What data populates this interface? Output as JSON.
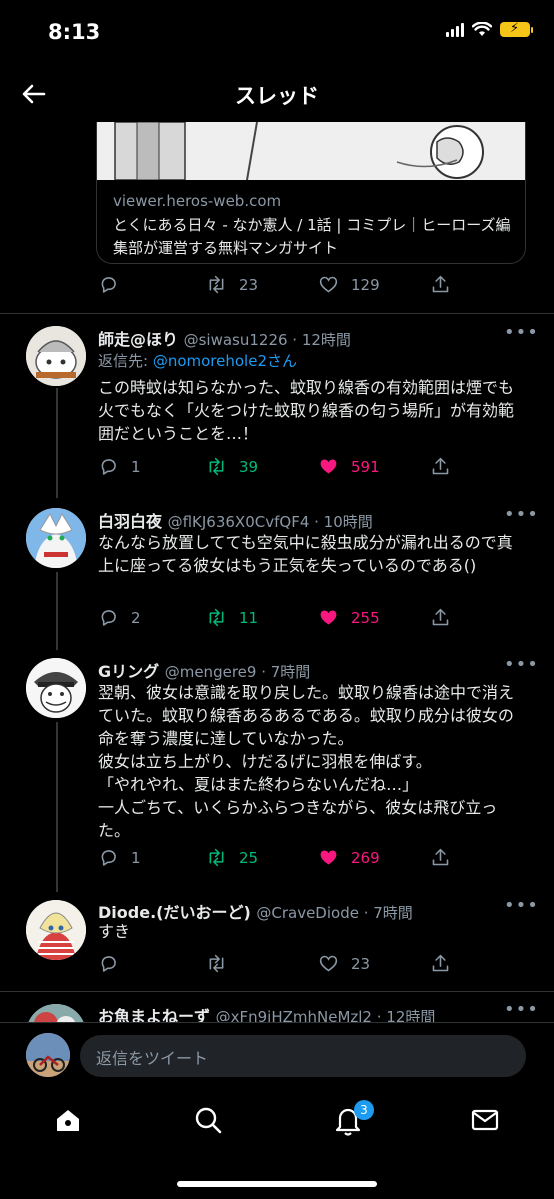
{
  "status_bar": {
    "time": "8:13"
  },
  "header": {
    "title": "スレッド"
  },
  "link_card": {
    "domain": "viewer.heros-web.com",
    "title": "とくにある日々 - なか憲人 / 1話 | コミプレ｜ヒーローズ編集部が運営する無料マンガサイト"
  },
  "top_actions": {
    "retweets": "23",
    "likes": "129"
  },
  "tweets": [
    {
      "name": "師走@ほり",
      "handle": "@siwasu1226 · 12時間",
      "reply_prefix": "返信先: ",
      "reply_to": "@nomorehole2さん",
      "text": "この時蚊は知らなかった、蚊取り線香の有効範囲は煙でも火でもなく「火をつけた蚊取り線香の匂う場所」が有効範囲だということを…！",
      "replies": "1",
      "retweets": "39",
      "likes": "591"
    },
    {
      "name": "白羽白夜",
      "handle": "@flKJ636X0CvfQF4 · 10時間",
      "text": "なんなら放置してても空気中に殺虫成分が漏れ出るので真上に座ってる彼女はもう正気を失っているのである()",
      "replies": "2",
      "retweets": "11",
      "likes": "255"
    },
    {
      "name": "Gリング",
      "handle": "@mengere9 · 7時間",
      "text": "翌朝、彼女は意識を取り戻した。蚊取り線香は途中で消えていた。蚊取り線香あるあるである。蚊取り成分は彼女の命を奪う濃度に達していなかった。\n彼女は立ち上がり、けだるげに羽根を伸ばす。\n「やれやれ、夏はまた終わらないんだね…」\n一人ごちて、いくらかふらつきながら、彼女は飛び立った。",
      "replies": "1",
      "retweets": "25",
      "likes": "269"
    },
    {
      "name": "Diode.(だいおーど)",
      "handle": "@CraveDiode · 7時間",
      "text": "すき",
      "replies": "",
      "retweets": "",
      "likes": "23"
    },
    {
      "name": "お魚まよねーず",
      "handle": "@xFn9jHZmhNeMzl2 · 12時間"
    }
  ],
  "reply_bar": {
    "placeholder": "返信をツイート"
  },
  "tabbar": {
    "notifications_badge": "3"
  },
  "colors": {
    "accent": "#1d9bf0",
    "retweet": "#00ba7c",
    "like": "#f91880",
    "muted": "#8b98a5"
  }
}
